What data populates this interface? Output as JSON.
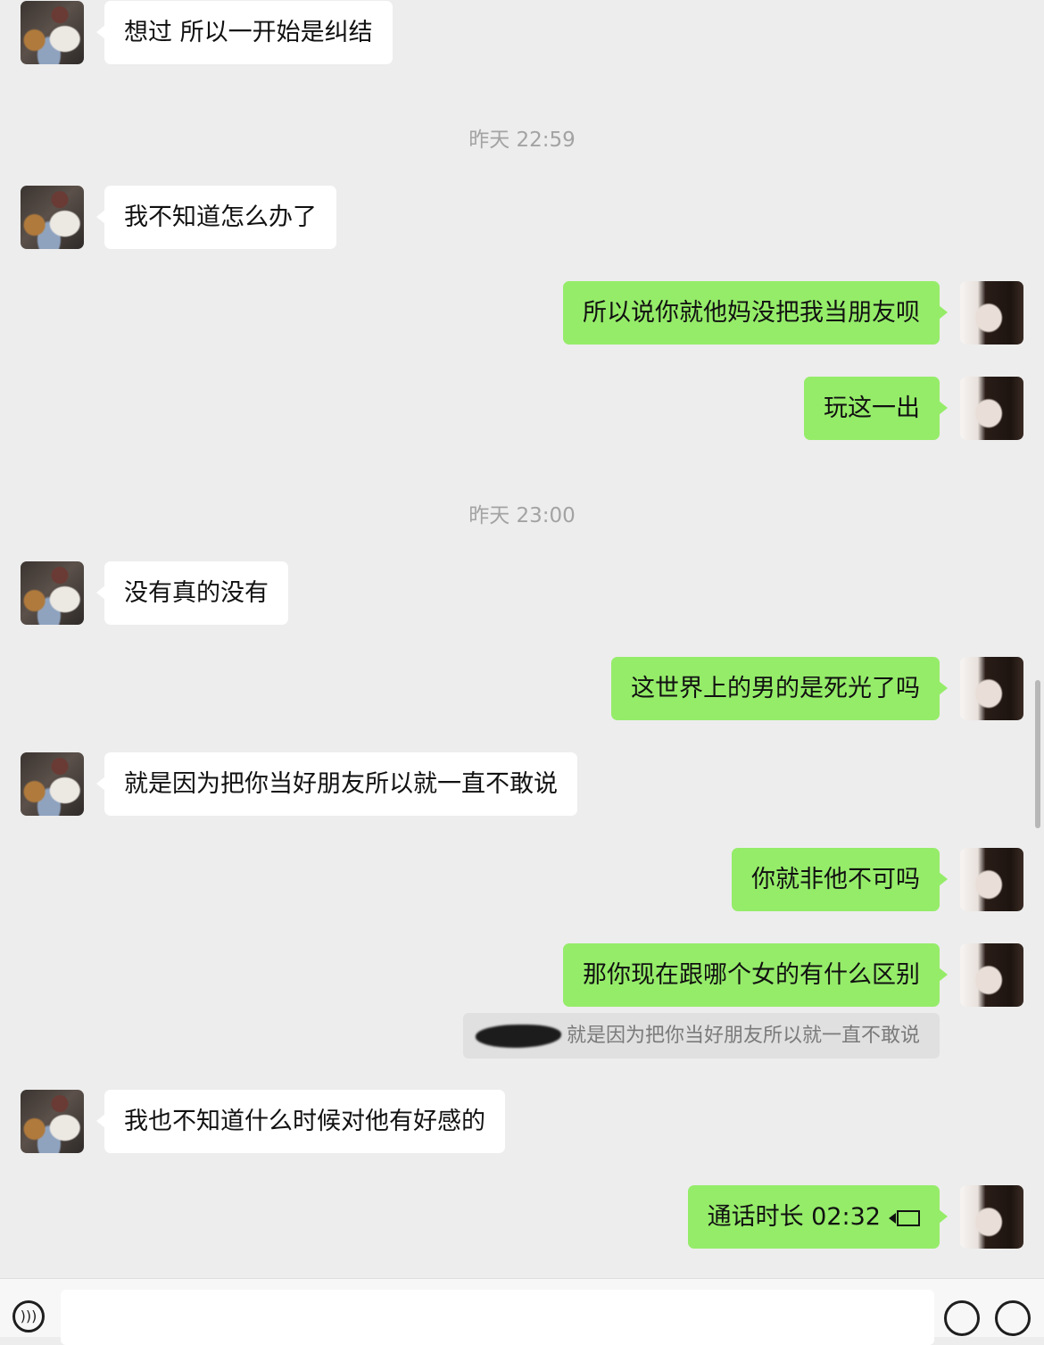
{
  "timestamps": [
    "昨天 22:59",
    "昨天 23:00"
  ],
  "messages": [
    {
      "side": "left",
      "text": "想过  所以一开始是纠结"
    },
    {
      "side": "left",
      "text": "我不知道怎么办了"
    },
    {
      "side": "right",
      "text": "所以说你就他妈没把我当朋友呗"
    },
    {
      "side": "right",
      "text": "玩这一出"
    },
    {
      "side": "left",
      "text": "没有真的没有"
    },
    {
      "side": "right",
      "text": "这世界上的男的是死光了吗"
    },
    {
      "side": "left",
      "text": "就是因为把你当好朋友所以就一直不敢说"
    },
    {
      "side": "right",
      "text": "你就非他不可吗"
    },
    {
      "side": "right",
      "text": "那你现在跟哪个女的有什么区别"
    },
    {
      "side": "left",
      "text": "我也不知道什么时候对他有好感的"
    },
    {
      "side": "right",
      "text": "通话时长 02:32"
    }
  ],
  "quote": {
    "text": "就是因为把你当好朋友所以就一直不敢说"
  },
  "colors": {
    "background": "#ededed",
    "sent_bubble": "#95ec69",
    "received_bubble": "#ffffff"
  },
  "input_bar": {
    "voice_icon": "voice-icon",
    "emoji_icon": "emoji-icon",
    "plus_icon": "plus-icon"
  }
}
